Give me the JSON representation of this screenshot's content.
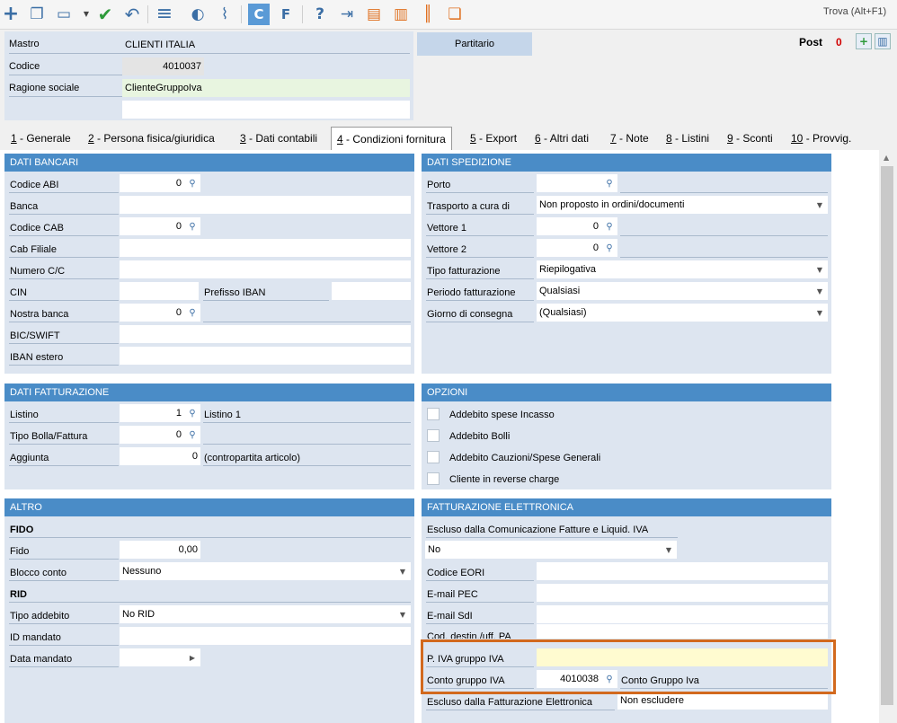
{
  "toolbar": {
    "find_label": "Trova (Alt+F1)",
    "buttons": [
      {
        "icon": "plus-icon",
        "glyph": "+"
      },
      {
        "icon": "copy-icon",
        "glyph": "❐"
      },
      {
        "icon": "open-folder-icon",
        "glyph": "▭"
      },
      {
        "icon": "chevron-down-icon",
        "glyph": "▼"
      },
      {
        "icon": "check-icon",
        "glyph": "✔"
      },
      {
        "icon": "undo-icon",
        "glyph": "↶"
      },
      {
        "icon": "menu-icon",
        "glyph": "≡"
      },
      {
        "icon": "user-icon",
        "glyph": "◐"
      },
      {
        "icon": "attachment-icon",
        "glyph": "⌇"
      },
      {
        "icon": "c-letter-icon",
        "glyph": "C"
      },
      {
        "icon": "f-letter-icon",
        "glyph": "F"
      },
      {
        "icon": "help-icon",
        "glyph": "?"
      },
      {
        "icon": "export-icon",
        "glyph": "⇥"
      },
      {
        "icon": "printer-icon",
        "glyph": "▤"
      },
      {
        "icon": "print-preview-icon",
        "glyph": "▥"
      },
      {
        "icon": "barcode-icon",
        "glyph": "║"
      },
      {
        "icon": "duplicate-docs-icon",
        "glyph": "❏"
      }
    ]
  },
  "header": {
    "mastro_label": "Mastro",
    "mastro_value": "CLIENTI ITALIA",
    "codice_label": "Codice",
    "codice_value": "4010037",
    "ragione_label": "Ragione sociale",
    "ragione_value": "ClienteGruppoIva",
    "ragione_value2": "",
    "partitario_label": "Partitario",
    "post_label": "Post",
    "post_count": "0"
  },
  "tabs": [
    {
      "num": "1",
      "label": " - Generale"
    },
    {
      "num": "2",
      "label": " - Persona fisica/giuridica"
    },
    {
      "num": "3",
      "label": " - Dati contabili"
    },
    {
      "num": "4",
      "label": " - Condizioni fornitura"
    },
    {
      "num": "5",
      "label": " - Export"
    },
    {
      "num": "6",
      "label": " - Altri dati"
    },
    {
      "num": "7",
      "label": " - Note"
    },
    {
      "num": "8",
      "label": " - Listini"
    },
    {
      "num": "9",
      "label": " - Sconti"
    },
    {
      "num": "10",
      "label": " - Provvig."
    }
  ],
  "dati_bancari": {
    "title": "DATI BANCARI",
    "abi_label": "Codice ABI",
    "abi_value": "0",
    "banca_label": "Banca",
    "banca_value": "",
    "cab_label": "Codice CAB",
    "cab_value": "0",
    "cab_filiale_label": "Cab Filiale",
    "cab_filiale_value": "",
    "conto_label": "Numero C/C",
    "conto_value": "",
    "cin_label": "CIN",
    "cin_value": "",
    "prefisso_label": "Prefisso IBAN",
    "prefisso_value": "",
    "nostra_banca_label": "Nostra banca",
    "nostra_banca_value": "0",
    "nostra_banca_desc": "",
    "bic_label": "BIC/SWIFT",
    "bic_value": "",
    "iban_estero_label": "IBAN estero",
    "iban_estero_value": ""
  },
  "dati_spedizione": {
    "title": "DATI SPEDIZIONE",
    "porto_label": "Porto",
    "porto_value": "",
    "porto_desc": "",
    "trasporto_label": "Trasporto a cura di",
    "trasporto_value": "Non proposto in ordini/documenti",
    "vettore1_label": "Vettore 1",
    "vettore1_value": "0",
    "vettore1_desc": "",
    "vettore2_label": "Vettore 2",
    "vettore2_value": "0",
    "vettore2_desc": "",
    "tipo_fatt_label": "Tipo fatturazione",
    "tipo_fatt_value": "Riepilogativa",
    "periodo_label": "Periodo fatturazione",
    "periodo_value": "Qualsiasi",
    "giorno_label": "Giorno di consegna",
    "giorno_value": "(Qualsiasi)"
  },
  "dati_fatturazione": {
    "title": "DATI FATTURAZIONE",
    "listino_label": "Listino",
    "listino_value": "1",
    "listino_desc": "Listino 1",
    "bolla_label": "Tipo Bolla/Fattura",
    "bolla_value": "0",
    "bolla_desc": "",
    "aggiunta_label": "Aggiunta",
    "aggiunta_value": "0",
    "aggiunta_desc": "(contropartita articolo)"
  },
  "opzioni": {
    "title": "OPZIONI",
    "items": [
      "Addebito spese Incasso",
      "Addebito Bolli",
      "Addebito Cauzioni/Spese Generali",
      "Cliente in reverse charge"
    ]
  },
  "altro": {
    "title": "ALTRO",
    "fido_heading": "FIDO",
    "fido_label": "Fido",
    "fido_value": "0,00",
    "blocco_label": "Blocco conto",
    "blocco_value": "Nessuno",
    "rid_heading": "RID",
    "tipo_addebito_label": "Tipo addebito",
    "tipo_addebito_value": "No RID",
    "id_mandato_label": "ID mandato",
    "id_mandato_value": "",
    "data_mandato_label": "Data mandato",
    "data_mandato_value": ""
  },
  "fattura_elettronica": {
    "title": "FATTURAZIONE ELETTRONICA",
    "escluso_com_label": "Escluso dalla Comunicazione Fatture e Liquid. IVA",
    "escluso_com_value": "No",
    "eori_label": "Codice EORI",
    "eori_value": "",
    "pec_label": "E-mail PEC",
    "pec_value": "",
    "sdi_label": "E-mail SdI",
    "sdi_value": "",
    "cod_destin_label": "Cod. destin./uff. PA",
    "cod_destin_value": "",
    "piva_gruppo_label": "P. IVA gruppo IVA",
    "piva_gruppo_value": "",
    "conto_gruppo_label": "Conto gruppo IVA",
    "conto_gruppo_value": "4010038",
    "conto_gruppo_desc": "Conto Gruppo Iva",
    "escluso_fe_label": "Escluso dalla Fatturazione Elettronica",
    "escluso_fe_value": "Non escludere"
  },
  "colors": {
    "accent": "#4a8cc7",
    "panel_bg": "#dde5f0",
    "highlight_border": "#d2691e",
    "yellow_field": "#fffbd0",
    "green_field": "#e8f5e0",
    "post_count": "#d00000"
  }
}
